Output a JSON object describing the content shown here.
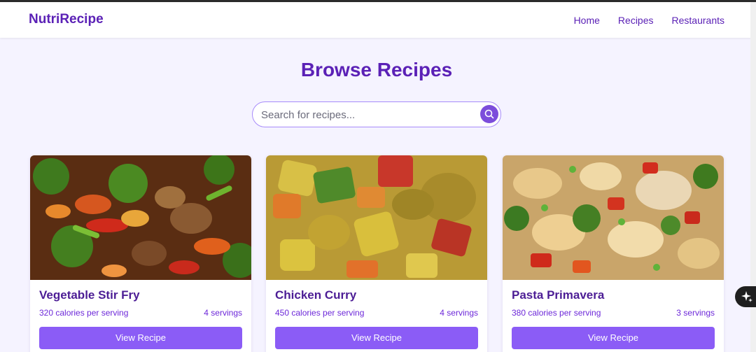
{
  "brand": "NutriRecipe",
  "nav": [
    {
      "label": "Home"
    },
    {
      "label": "Recipes"
    },
    {
      "label": "Restaurants"
    }
  ],
  "page_title": "Browse Recipes",
  "search": {
    "placeholder": "Search for recipes...",
    "icon": "search-icon"
  },
  "recipes": [
    {
      "title": "Vegetable Stir Fry",
      "calories": "320 calories per serving",
      "servings": "4 servings",
      "button": "View Recipe"
    },
    {
      "title": "Chicken Curry",
      "calories": "450 calories per serving",
      "servings": "4 servings",
      "button": "View Recipe"
    },
    {
      "title": "Pasta Primavera",
      "calories": "380 calories per serving",
      "servings": "3 servings",
      "button": "View Recipe"
    }
  ],
  "colors": {
    "brand": "#5b21b6",
    "accent": "#8b5cf6",
    "background": "#f5f3ff"
  },
  "fab_icon": "sparkle-icon"
}
